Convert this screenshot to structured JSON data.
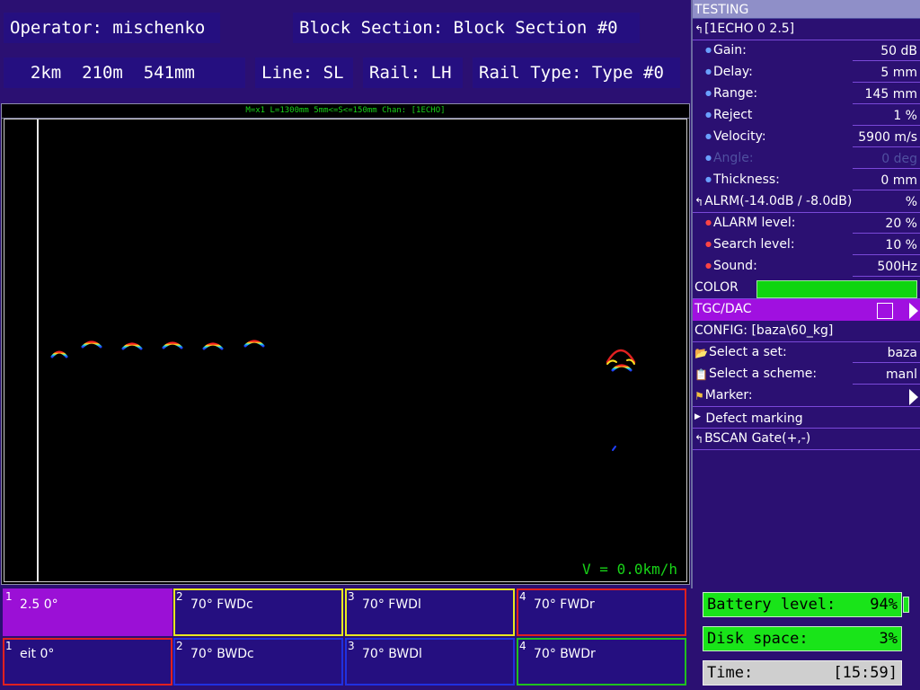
{
  "header": {
    "operator": "Operator: mischenko",
    "block_section": "Block Section: Block Section #0",
    "position": "  2km  210m  541mm",
    "line": "Line: SL",
    "rail": "Rail: LH",
    "rail_type": "Rail Type: Type #0"
  },
  "scope": {
    "status_line": "M=x1  L=1300mm 5mm<=S<=150mm Chan: [1ECHO]",
    "speed": "V = 0.0km/h"
  },
  "panel": {
    "title": "TESTING",
    "channel_header": "[1ECHO 0 2.5]",
    "params": [
      {
        "label": "Gain:",
        "value": "50 dB"
      },
      {
        "label": "Delay:",
        "value": "5 mm"
      },
      {
        "label": "Range:",
        "value": "145 mm"
      },
      {
        "label": "Reject",
        "value": "1 %"
      },
      {
        "label": "Velocity:",
        "value": "5900 m/s"
      },
      {
        "label": "Angle:",
        "value": "0 deg"
      },
      {
        "label": "Thickness:",
        "value": "0 mm"
      }
    ],
    "alarm_header": {
      "label": "ALRM(-14.0dB / -8.0dB)",
      "value": "%"
    },
    "alarm_params": [
      {
        "label": "ALARM level:",
        "value": "20 %"
      },
      {
        "label": "Search level:",
        "value": "10 %"
      },
      {
        "label": "Sound:",
        "value": "500Hz"
      }
    ],
    "color_label": "COLOR",
    "color_value": "#0fd50f",
    "tgc_label": "TGC/DAC",
    "config_label": "CONFIG: [baza\\60_kg]",
    "select_set": {
      "label": "Select a set:",
      "value": "baza"
    },
    "select_scheme": {
      "label": "Select a scheme:",
      "value": "manl"
    },
    "marker_label": "Marker:",
    "defect_marking_label": "Defect marking",
    "bscan_gate_label": "BSCAN Gate(+,-)"
  },
  "channels": [
    {
      "num": "1",
      "label": "2.5 0°",
      "border": "#9b10d6",
      "selected": true
    },
    {
      "num": "2",
      "label": "70°  FWDc",
      "border": "#e8e820",
      "selected": false
    },
    {
      "num": "3",
      "label": "70°  FWDl",
      "border": "#e8e820",
      "selected": false
    },
    {
      "num": "4",
      "label": "70°  FWDr",
      "border": "#e02020",
      "selected": false
    },
    {
      "num": "1",
      "label": "eit  0°",
      "border": "#e02020",
      "selected": false
    },
    {
      "num": "2",
      "label": "70°  BWDc",
      "border": "#2030e0",
      "selected": false
    },
    {
      "num": "3",
      "label": "70°  BWDl",
      "border": "#2030e0",
      "selected": false
    },
    {
      "num": "4",
      "label": "70°  BWDr",
      "border": "#20c020",
      "selected": false
    }
  ],
  "status": {
    "battery_label": "Battery level:",
    "battery_value": "94%",
    "disk_label": "Disk space:",
    "disk_value": "3%",
    "time_label": "Time:",
    "time_value": "[15:59]"
  }
}
